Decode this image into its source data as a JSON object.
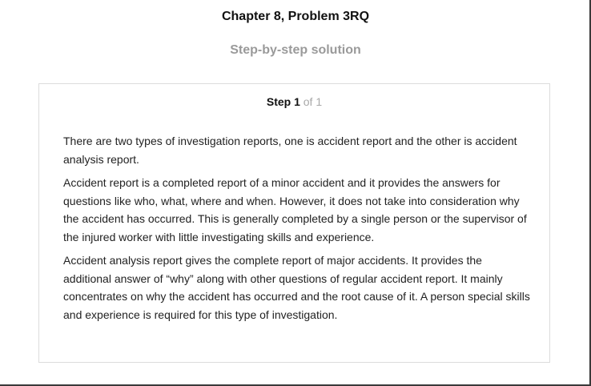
{
  "header": {
    "chapter_title": "Chapter 8, Problem 3RQ",
    "subtitle": "Step-by-step solution"
  },
  "step": {
    "label": "Step 1",
    "of_text": "of 1",
    "paragraphs": [
      "There are two types of investigation reports, one is accident report and the other is accident analysis report.",
      "Accident report is a completed report of a minor accident and it provides the answers for questions like who, what, where and when. However, it does not take into consideration why the accident has occurred. This is generally completed by a single person or the supervisor of the injured worker with little investigating skills and experience.",
      "Accident analysis report gives the complete report of major accidents. It provides the additional answer of “why” along with other questions of regular accident report. It mainly concentrates on why the accident has occurred and the root cause of it. A person special skills and experience is required for this type of investigation."
    ]
  }
}
